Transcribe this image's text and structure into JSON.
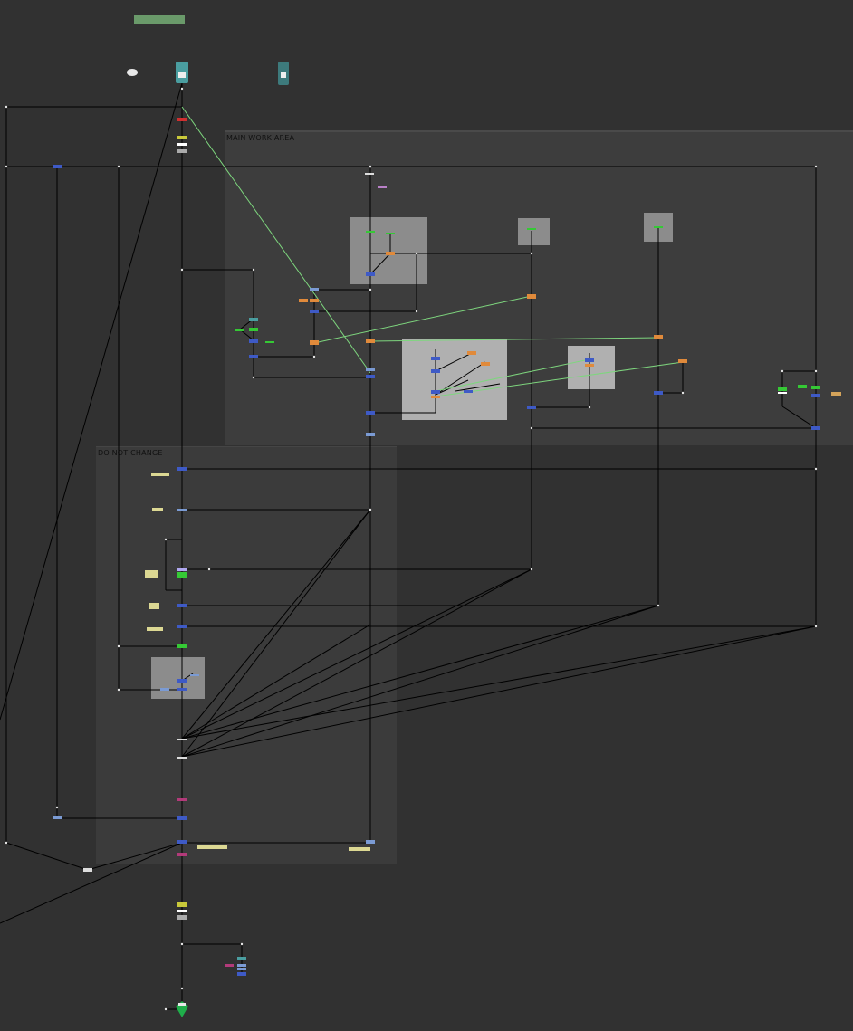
{
  "canvas": {
    "background": "#313131"
  },
  "backdrops": {
    "main_work_area": {
      "label": "MAIN WORK AREA",
      "color": "#3d3d3d"
    },
    "do_not_change": {
      "label": "DO NOT CHANGE",
      "color": "#3b3b3b"
    }
  },
  "node_colors": {
    "merge": "#3e5ac6",
    "grade": "#e08a3b",
    "transform": "#7b9bd4",
    "color_correct": "#35c935",
    "roto": "#b33a7a",
    "sticky_note": "#dcd893",
    "read": "#4a9ea0",
    "write": "#1fae4a",
    "dot": "#cccccc",
    "link": "#000000",
    "expression_link": "#7ed67e",
    "group_box": "#8a8a8a",
    "group_box_light": "#b0b0b0"
  }
}
